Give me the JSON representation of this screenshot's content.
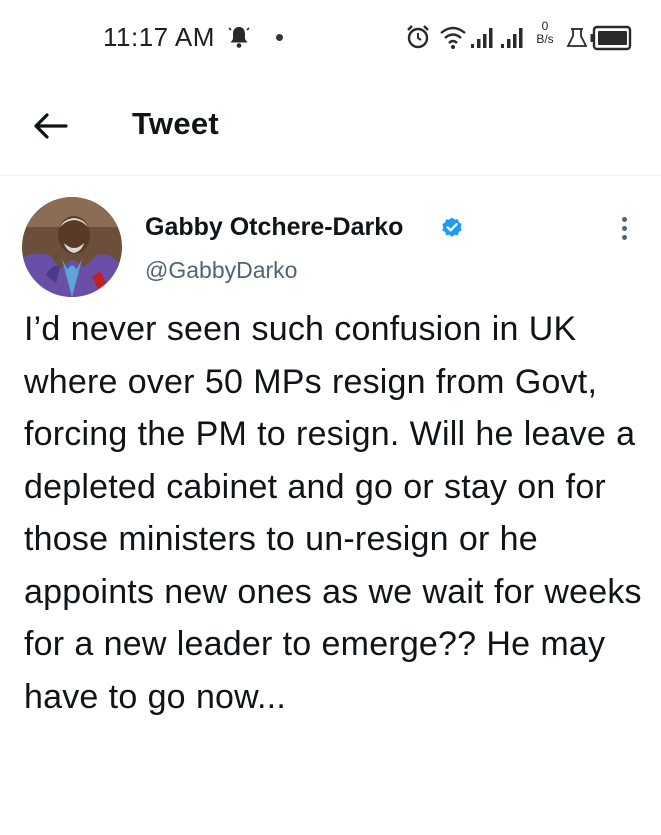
{
  "status_bar": {
    "time": "11:17 AM",
    "net_speed_value": "0",
    "net_speed_unit": "B/s",
    "icons": [
      "notification-bell-icon",
      "alarm-icon",
      "wifi-icon",
      "signal-icon",
      "signal-icon",
      "flask-icon",
      "battery-icon"
    ]
  },
  "header": {
    "title": "Tweet",
    "back_icon": "arrow-left-icon"
  },
  "tweet": {
    "author_name": "Gabby Otchere-Darko",
    "handle": "@GabbyDarko",
    "verified": true,
    "verified_color": "#1d9bf0",
    "text": "I’d never seen such confusion in UK where over 50 MPs resign from Govt, forcing the PM to resign. Will he leave a depleted cabinet and go or stay on for those ministers to un-resign or he appoints new ones as we wait for weeks for a new leader to emerge?? He may have to go now..."
  }
}
